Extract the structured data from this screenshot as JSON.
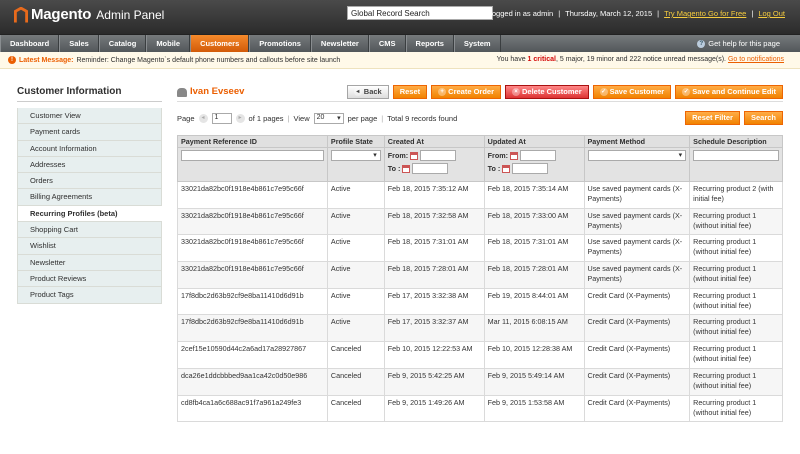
{
  "header": {
    "logo_main": "Magento",
    "logo_sub": "Admin Panel",
    "search_value": "Global Record Search",
    "logged_in": "Logged in as admin",
    "sep1": "|",
    "date": "Thursday, March 12, 2015",
    "sep2": "|",
    "try_link": "Try Magento Go for Free",
    "sep3": "|",
    "logout": "Log Out"
  },
  "nav": {
    "items": [
      "Dashboard",
      "Sales",
      "Catalog",
      "Mobile",
      "Customers",
      "Promotions",
      "Newsletter",
      "CMS",
      "Reports",
      "System"
    ],
    "help": "Get help for this page"
  },
  "message": {
    "latest_label": "Latest Message:",
    "latest_text": "Reminder: Change Magento`s default phone numbers and callouts before site launch",
    "right_pre": "You have",
    "critical": "1 critical",
    "right_mid": ", 5 major, 19 minor and 222 notice unread message(s).",
    "link": "Go to notifications"
  },
  "sidebar": {
    "title": "Customer Information",
    "items": [
      "Customer View",
      "Payment cards",
      "Account Information",
      "Addresses",
      "Orders",
      "Billing Agreements",
      "Recurring Profiles (beta)",
      "Shopping Cart",
      "Wishlist",
      "Newsletter",
      "Product Reviews",
      "Product Tags"
    ]
  },
  "page": {
    "title": "Ivan Evseev",
    "buttons": {
      "back": "Back",
      "reset": "Reset",
      "create_order": "Create Order",
      "delete": "Delete Customer",
      "save": "Save Customer",
      "save_continue": "Save and Continue Edit"
    }
  },
  "pager": {
    "page_label": "Page",
    "page_value": "1",
    "of_pages": "of 1 pages",
    "view_label": "View",
    "per_page_value": "20",
    "per_page_label": "per page",
    "records": "Total 9 records found",
    "reset_filter": "Reset Filter",
    "search": "Search"
  },
  "grid": {
    "columns": [
      "Payment Reference ID",
      "Profile State",
      "Created At",
      "Updated At",
      "Payment Method",
      "Schedule Description"
    ],
    "filter_from": "From:",
    "filter_to": "To :",
    "rows": [
      [
        "33021da82bc0f1918e4b861c7e95c66f",
        "Active",
        "Feb 18, 2015 7:35:12 AM",
        "Feb 18, 2015 7:35:14 AM",
        "Use saved payment cards (X-Payments)",
        "Recurring product 2 (with initial fee)"
      ],
      [
        "33021da82bc0f1918e4b861c7e95c66f",
        "Active",
        "Feb 18, 2015 7:32:58 AM",
        "Feb 18, 2015 7:33:00 AM",
        "Use saved payment cards (X-Payments)",
        "Recurring product 1 (without initial fee)"
      ],
      [
        "33021da82bc0f1918e4b861c7e95c66f",
        "Active",
        "Feb 18, 2015 7:31:01 AM",
        "Feb 18, 2015 7:31:01 AM",
        "Use saved payment cards (X-Payments)",
        "Recurring product 1 (without initial fee)"
      ],
      [
        "33021da82bc0f1918e4b861c7e95c66f",
        "Active",
        "Feb 18, 2015 7:28:01 AM",
        "Feb 18, 2015 7:28:01 AM",
        "Use saved payment cards (X-Payments)",
        "Recurring product 1 (without initial fee)"
      ],
      [
        "17f8dbc2d63b92cf9e8ba11410d6d91b",
        "Active",
        "Feb 17, 2015 3:32:38 AM",
        "Feb 19, 2015 8:44:01 AM",
        "Credit Card (X-Payments)",
        "Recurring product 1 (without initial fee)"
      ],
      [
        "17f8dbc2d63b92cf9e8ba11410d6d91b",
        "Active",
        "Feb 17, 2015 3:32:37 AM",
        "Mar 11, 2015 6:08:15 AM",
        "Credit Card (X-Payments)",
        "Recurring product 1 (without initial fee)"
      ],
      [
        "2cef15e10590d44c2a6ad17a28927867",
        "Canceled",
        "Feb 10, 2015 12:22:53 AM",
        "Feb 10, 2015 12:28:38 AM",
        "Credit Card (X-Payments)",
        "Recurring product 1 (without initial fee)"
      ],
      [
        "dca26e1ddcbbbed9aa1ca42c0d50e986",
        "Canceled",
        "Feb 9, 2015 5:42:25 AM",
        "Feb 9, 2015 5:49:14 AM",
        "Credit Card (X-Payments)",
        "Recurring product 1 (without initial fee)"
      ],
      [
        "cd8fb4ca1a6c688ac91f7a961a249fe3",
        "Canceled",
        "Feb 9, 2015 1:49:26 AM",
        "Feb 9, 2015 1:53:58 AM",
        "Credit Card (X-Payments)",
        "Recurring product 1 (without initial fee)"
      ]
    ]
  },
  "colors": {
    "accent": "#eb5e00",
    "nav_bg": "#52575a",
    "button": "#f18200"
  }
}
